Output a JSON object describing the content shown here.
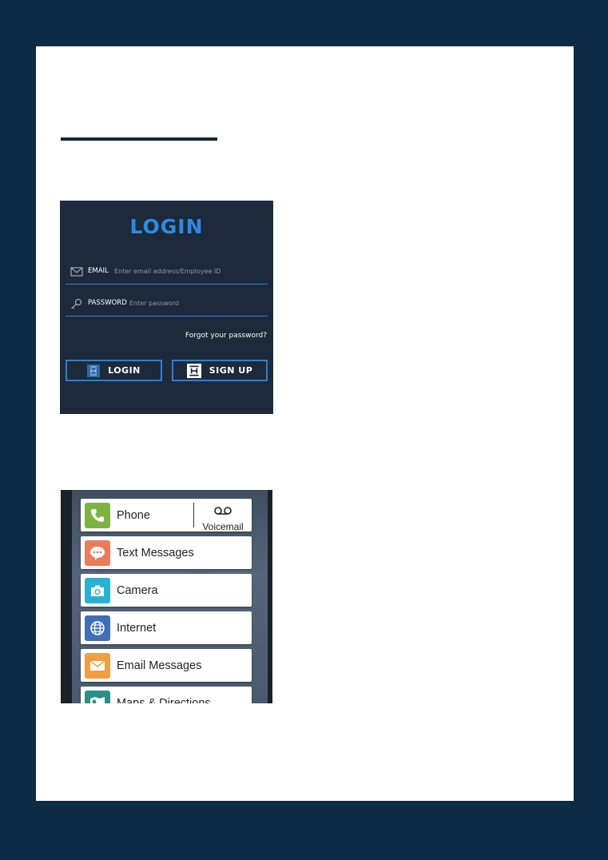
{
  "login": {
    "title": "LOGIN",
    "email_label": "EMAIL",
    "email_placeholder": "Enter email address/Employee ID",
    "password_label": "PASSWORD",
    "password_placeholder": "Enter password",
    "forgot": "Forgot your password?",
    "login_button": "LOGIN",
    "signup_button": "SIGN UP",
    "colors": {
      "panel": "#1c2a3c",
      "accent": "#2b8be6"
    }
  },
  "launcher": {
    "items": [
      {
        "label": "Phone",
        "icon": "phone-icon",
        "color": "#7cb342"
      },
      {
        "label": "Text Messages",
        "icon": "chat-bubble-icon",
        "color": "#ea7b5c"
      },
      {
        "label": "Camera",
        "icon": "camera-icon",
        "color": "#26b3d3"
      },
      {
        "label": "Internet",
        "icon": "globe-icon",
        "color": "#3f6fb4"
      },
      {
        "label": "Email Messages",
        "icon": "envelope-icon",
        "color": "#f0a042"
      },
      {
        "label": "Maps & Directions",
        "icon": "map-icon",
        "color": "#26908a"
      }
    ],
    "voicemail_label": "Voicemail"
  }
}
